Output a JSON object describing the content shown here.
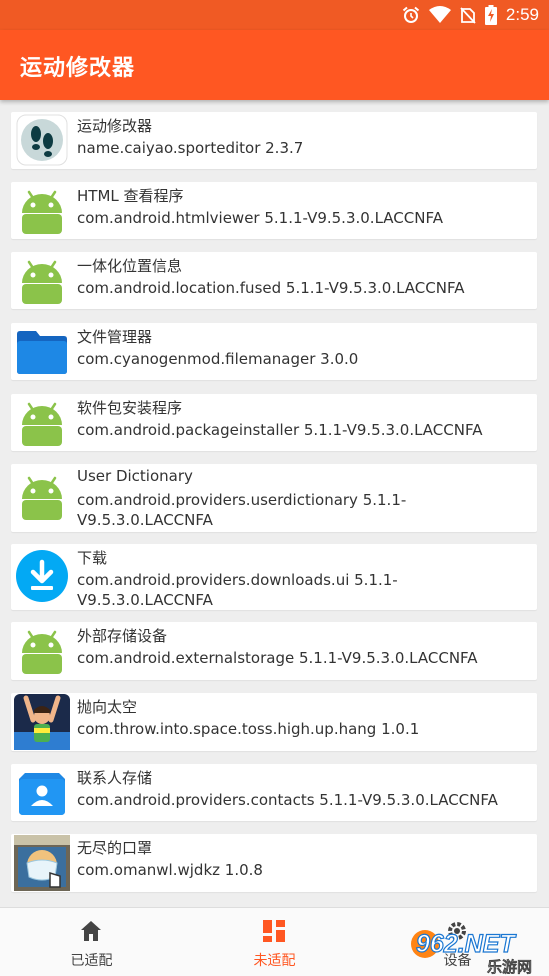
{
  "status_bar": {
    "time": "2:59"
  },
  "app_bar": {
    "title": "运动修改器"
  },
  "apps": [
    {
      "name": "运动修改器",
      "package": "name.caiyao.sporteditor 2.3.7",
      "icon": "footprints-icon"
    },
    {
      "name": "HTML 查看程序",
      "package": "com.android.htmlviewer 5.1.1-V9.5.3.0.LACCNFA",
      "icon": "android-icon"
    },
    {
      "name": "一体化位置信息",
      "package": "com.android.location.fused 5.1.1-V9.5.3.0.LACCNFA",
      "icon": "android-icon"
    },
    {
      "name": "文件管理器",
      "package": "com.cyanogenmod.filemanager 3.0.0",
      "icon": "folder-icon"
    },
    {
      "name": "软件包安装程序",
      "package": "com.android.packageinstaller 5.1.1-V9.5.3.0.LACCNFA",
      "icon": "android-icon"
    },
    {
      "name": "User Dictionary",
      "package": "com.android.providers.userdictionary 5.1.1-V9.5.3.0.LACCNFA",
      "icon": "android-icon"
    },
    {
      "name": "下载",
      "package": "com.android.providers.downloads.ui 5.1.1-V9.5.3.0.LACCNFA",
      "icon": "download-icon"
    },
    {
      "name": "外部存储设备",
      "package": "com.android.externalstorage 5.1.1-V9.5.3.0.LACCNFA",
      "icon": "android-icon"
    },
    {
      "name": "抛向太空",
      "package": "com.throw.into.space.toss.high.up.hang 1.0.1",
      "icon": "game-character-icon"
    },
    {
      "name": "联系人存储",
      "package": "com.android.providers.contacts 5.1.1-V9.5.3.0.LACCNFA",
      "icon": "contacts-icon"
    },
    {
      "name": "无尽的口罩",
      "package": "com.omanwl.wjdkz 1.0.8",
      "icon": "mask-game-icon"
    }
  ],
  "bottom_nav": {
    "tabs": [
      {
        "label": "已适配",
        "icon": "home-icon",
        "active": false
      },
      {
        "label": "未适配",
        "icon": "grid-icon",
        "active": true
      },
      {
        "label": "设备",
        "icon": "settings-icon",
        "active": false
      }
    ]
  },
  "watermark": {
    "text": "962.NET",
    "subtext": "乐游网"
  },
  "colors": {
    "primary": "#ff5722",
    "status_bar": "#f05a24",
    "active_tab": "#ff5722",
    "inactive_tab": "#444444"
  }
}
